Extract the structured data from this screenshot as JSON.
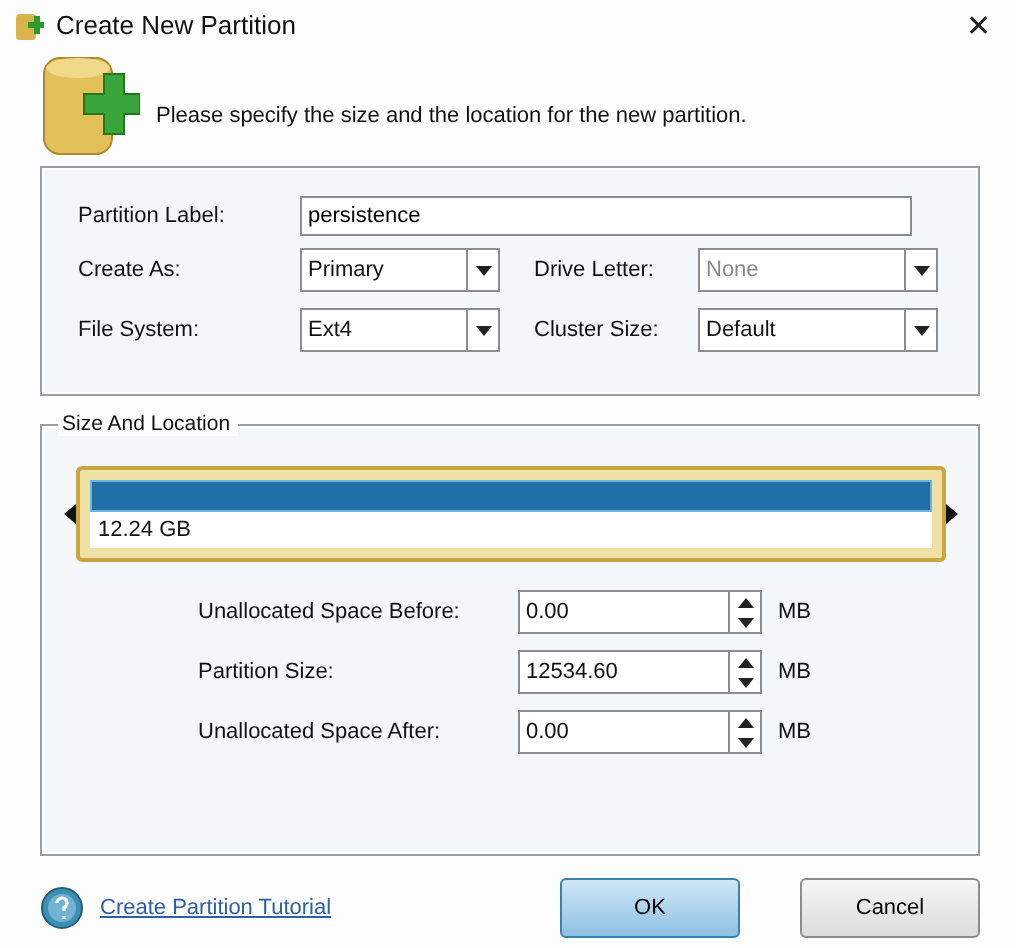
{
  "window": {
    "title": "Create New Partition",
    "close": "✕"
  },
  "header": {
    "message": "Please specify the size and the location for the new partition."
  },
  "properties": {
    "label_field": {
      "label": "Partition Label:",
      "value": "persistence"
    },
    "selects": [
      {
        "label": "Create As:",
        "value": "Primary",
        "disabled": false
      },
      {
        "label": "Drive Letter:",
        "value": "None",
        "disabled": true
      },
      {
        "label": "File System:",
        "value": "Ext4",
        "disabled": false
      },
      {
        "label": "Cluster Size:",
        "value": "Default",
        "disabled": false
      }
    ]
  },
  "size_and_location": {
    "title": "Size And Location",
    "disk_bar": {
      "size": "12.24 GB"
    },
    "spinners": [
      {
        "label": "Unallocated Space Before:",
        "value": "0.00",
        "unit": "MB"
      },
      {
        "label": "Partition Size:",
        "value": "12534.60",
        "unit": "MB"
      },
      {
        "label": "Unallocated Space After:",
        "value": "0.00",
        "unit": "MB"
      }
    ]
  },
  "footer": {
    "link": "Create Partition Tutorial",
    "buttons": [
      {
        "label": "OK",
        "kind": "default"
      },
      {
        "label": "Cancel",
        "kind": "normal"
      }
    ]
  }
}
